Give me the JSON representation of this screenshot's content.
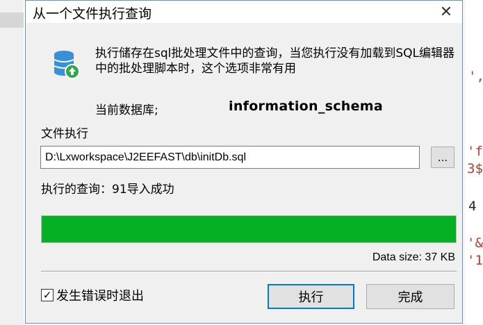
{
  "dialog": {
    "title": "从一个文件执行查询",
    "close_glyph": "✕",
    "description": "执行储存在sql批处理文件中的查询，当您执行没有加载到SQL编辑器中的批处理脚本时，这个选项非常有用",
    "current_db_label": "当前数据库;",
    "current_db_value": "information_schema",
    "file_label": "文件执行",
    "file_path": "D:\\Lxworkspace\\J2EEFAST\\db\\initDb.sql",
    "browse_label": "...",
    "status": "执行的查询：91导入成功",
    "progress": 1.0,
    "data_size": "Data size: 37 KB",
    "checkbox_label": "发生错误时退出",
    "checkbox_checked": true,
    "checkbox_glyph": "✓",
    "execute_label": "执行",
    "finish_label": "完成",
    "icon": "database-import-icon"
  },
  "background_code": {
    "line1": "',",
    "line2": "'f",
    "line3": "3$",
    "line4": "4",
    "line5": "'&",
    "line6": "'1"
  },
  "colors": {
    "progress_fill": "#06b025",
    "primary_border": "#0078d7",
    "icon_blue": "#3a8fd9",
    "icon_green": "#2fa84f"
  }
}
